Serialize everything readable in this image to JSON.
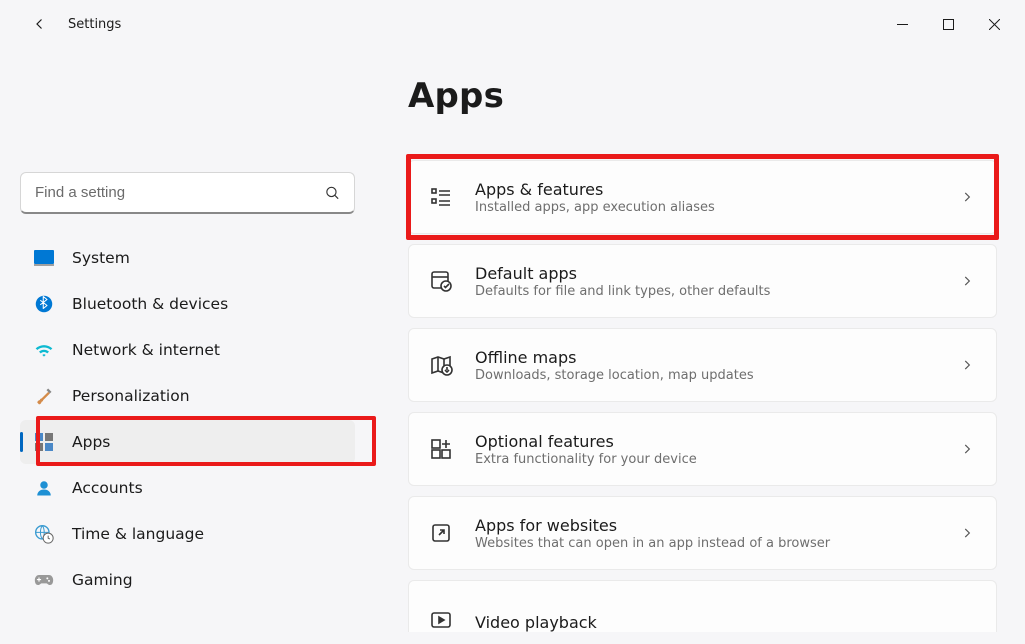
{
  "app": {
    "title": "Settings"
  },
  "search": {
    "placeholder": "Find a setting"
  },
  "sidebar": {
    "items": [
      {
        "label": "System"
      },
      {
        "label": "Bluetooth & devices"
      },
      {
        "label": "Network & internet"
      },
      {
        "label": "Personalization"
      },
      {
        "label": "Apps",
        "selected": true,
        "highlighted": true
      },
      {
        "label": "Accounts"
      },
      {
        "label": "Time & language"
      },
      {
        "label": "Gaming"
      }
    ]
  },
  "page": {
    "title": "Apps"
  },
  "cards": [
    {
      "title": "Apps & features",
      "subtitle": "Installed apps, app execution aliases",
      "highlighted": true
    },
    {
      "title": "Default apps",
      "subtitle": "Defaults for file and link types, other defaults"
    },
    {
      "title": "Offline maps",
      "subtitle": "Downloads, storage location, map updates"
    },
    {
      "title": "Optional features",
      "subtitle": "Extra functionality for your device"
    },
    {
      "title": "Apps for websites",
      "subtitle": "Websites that can open in an app instead of a browser"
    },
    {
      "title": "Video playback",
      "subtitle": ""
    }
  ]
}
